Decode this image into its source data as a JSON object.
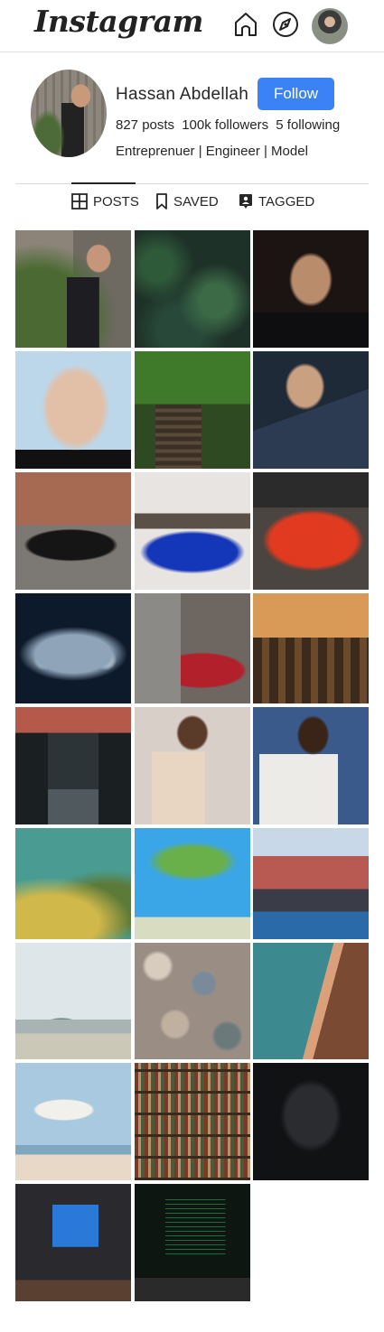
{
  "nav": {
    "logo": "Instagram",
    "home_icon": "home-icon",
    "explore_icon": "compass-icon",
    "avatar_icon": "avatar"
  },
  "profile": {
    "username": "Hassan Abdellah",
    "follow_label": "Follow",
    "posts": "827 posts",
    "followers": "100k followers",
    "following": "5 following",
    "bio": "Entreprenuer | Engineer | Model"
  },
  "tabs": [
    {
      "label": "POSTS",
      "icon": "grid-icon",
      "active": true
    },
    {
      "label": "SAVED",
      "icon": "bookmark-icon",
      "active": false
    },
    {
      "label": "TAGGED",
      "icon": "tag-icon",
      "active": false
    }
  ],
  "colors": {
    "accent": "#3b82f6",
    "text": "#262626",
    "divider": "#d9d9d9"
  },
  "posts": [
    {
      "subject": "man-sitting-wall",
      "bg": "linear-gradient(90deg,#8c8478 0 50%,#6e6a62 50%)",
      "detail": "radial-gradient(ellipse 14px 16px at 72% 24%, #c6967a 0 90%, transparent 100%), linear-gradient(180deg, transparent 0 40%, #1e1e22 40% 100%) 62% 0/28% 100% no-repeat, radial-gradient(ellipse at 20% 75%, #4b6a33 0 40%, transparent 60%)"
    },
    {
      "subject": "pine-trees",
      "bg": "#1e3128",
      "detail": "radial-gradient(circle at 20% 30%, #2f5a3a 0 12%, transparent 30%), radial-gradient(circle at 70% 60%, #3c6a47 0 15%, transparent 35%), radial-gradient(circle at 40% 85%, #28493a 0 18%, transparent 38%)"
    },
    {
      "subject": "man-glasses-dark",
      "bg": "#1b1412",
      "detail": "radial-gradient(ellipse 24px 30px at 50% 42%, #b98c6c 0 85%, transparent 100%), linear-gradient(180deg, transparent 0 70%, #0e0e10 70% 100%)"
    },
    {
      "subject": "cartoon-portrait",
      "bg": "#bcd7ea",
      "detail": "radial-gradient(ellipse 38px 48px at 52% 48%, #e2c0a8 0 80%, transparent 100%), linear-gradient(180deg, transparent 0 84%, #111 84% 100%)"
    },
    {
      "subject": "railway-forest",
      "bg": "#2d4a22",
      "detail": "linear-gradient(180deg, #3f7a2a 0 45%, transparent 45%), repeating-linear-gradient(0deg, #5a4a3a 0 4px, #3a3026 4px 9px) 30% 100%/40% 55% no-repeat"
    },
    {
      "subject": "man-sunglasses",
      "bg": "#1f2a38",
      "detail": "radial-gradient(ellipse 22px 26px at 45% 30%, #c9a080 0 85%, transparent 100%), linear-gradient(160deg, transparent 0 50%, #2c3a52 50% 100%)"
    },
    {
      "subject": "black-car-street",
      "bg": "#7c7873",
      "detail": "linear-gradient(180deg, #a66a52 0 45%, transparent 45%), radial-gradient(ellipse 52px 18px at 48% 62%, #151515 0 90%, transparent 100%)"
    },
    {
      "subject": "blue-car",
      "bg": "#e8e4e2",
      "detail": "linear-gradient(180deg, transparent 0 35%, #5a5047 35% 48%, transparent 48%), radial-gradient(ellipse 58px 24px at 50% 68%, #1436b8 0 85%, transparent 100%)"
    },
    {
      "subject": "red-car",
      "bg": "#4a4540",
      "detail": "radial-gradient(ellipse 56px 34px at 52% 58%, #e03a20 0 85%, transparent 100%), linear-gradient(180deg, #2b2b2b 0 30%, transparent 30%)"
    },
    {
      "subject": "mercedes-front",
      "bg": "#0c1a2c",
      "detail": "radial-gradient(ellipse 60px 30px at 50% 55%, #8fa4b8 0 70%, transparent 100%), radial-gradient(circle at 25% 60%, #e8f2ff 0 6%, transparent 10%), radial-gradient(circle at 78% 60%, #e8f2ff 0 6%, transparent 10%)"
    },
    {
      "subject": "red-car-city",
      "bg": "#6e6660",
      "detail": "linear-gradient(90deg, #8b8a86 0 40%, transparent 40%), radial-gradient(ellipse 50px 20px at 58% 70%, #b2202b 0 90%, transparent 100%)"
    },
    {
      "subject": "city-street-sunset",
      "bg": "#5a3a22",
      "detail": "linear-gradient(180deg, #d89a56 0 40%, transparent 40%), repeating-linear-gradient(90deg, #3c2a1c 0 10px, #6b4a2c 10px 18px) 0 100%/100% 60% no-repeat"
    },
    {
      "subject": "city-road-dusk",
      "bg": "#2c3438",
      "detail": "linear-gradient(180deg, #b55a4a 0 22%, transparent 22%), linear-gradient(90deg, #1a2022 0 28%, transparent 28% 72%, #1a2022 72%), linear-gradient(180deg, transparent 0 70%, #505a5e 70%)"
    },
    {
      "subject": "man-headphones-book",
      "bg": "#d8d0c8",
      "detail": "radial-gradient(ellipse 18px 20px at 50% 22%, #5a3a28 0 85%, transparent 100%), linear-gradient(180deg, transparent 0 38%, #e8d6c2 38% 100%) 28% 0/46% 100% no-repeat"
    },
    {
      "subject": "man-chess",
      "bg": "#3a5a8c",
      "detail": "radial-gradient(ellipse 18px 22px at 52% 24%, #3a2418 0 85%, transparent 100%), linear-gradient(180deg, transparent 0 40%, #ecebe8 40% 100%) 18% 0/68% 100% no-repeat"
    },
    {
      "subject": "aerial-beach-trees",
      "bg": "#4a9c92",
      "detail": "radial-gradient(ellipse 90px 50px at 30% 85%, #d1b84a 0 60%, transparent 100%), radial-gradient(ellipse 70px 40px at 80% 70%, #5c7a38 0 60%, transparent 100%)"
    },
    {
      "subject": "palm-tree-sky",
      "bg": "#3aa6e8",
      "detail": "radial-gradient(ellipse 50px 22px at 50% 30%, #6ab04a 0 70%, transparent 100%), linear-gradient(180deg, transparent 0 80%, #d8dcc0 80% 100%)"
    },
    {
      "subject": "cinque-terre",
      "bg": "#c8d8e8",
      "detail": "linear-gradient(180deg, transparent 0 25%, #b85a52 25% 55%, #3a3c48 55% 75%, #2a6aa8 75% 100%)"
    },
    {
      "subject": "van-beach",
      "bg": "#dfe6ea",
      "detail": "linear-gradient(180deg, transparent 0 66%, #a8b4b4 66% 78%, #ccc8b8 78% 100%), radial-gradient(ellipse 22px 10px at 40% 72%, #6e8a7e 0 90%, transparent 100%)"
    },
    {
      "subject": "pebbles",
      "bg": "#9a8e84",
      "detail": "radial-gradient(circle at 20% 20%, #d8ccbf 0 9%, transparent 12%), radial-gradient(circle at 60% 35%, #7a8a9a 0 10%, transparent 13%), radial-gradient(circle at 35% 70%, #c0b0a0 0 11%, transparent 14%), radial-gradient(circle at 80% 80%, #6a7a7a 0 9%, transparent 12%)"
    },
    {
      "subject": "aerial-coast",
      "bg": "#3c8a90",
      "detail": "linear-gradient(105deg, transparent 0 55%, #d9a07a 55% 62%, #7a4a32 62% 100%)"
    },
    {
      "subject": "beach-umbrella",
      "bg": "#a9c9e0",
      "detail": "radial-gradient(ellipse 34px 12px at 42% 40%, #f2f0ea 0 90%, transparent 100%), linear-gradient(180deg, transparent 0 70%, #7fa8c0 70% 78%, #e8d8c8 78% 100%)"
    },
    {
      "subject": "library-shelves",
      "bg": "#2a2018",
      "detail": "repeating-linear-gradient(0deg, #3a2a1e 0 3px, transparent 3px 24px), repeating-linear-gradient(90deg, #7a3a28 0 4px, #b8906a 4px 7px, #4a5a3a 7px 11px)"
    },
    {
      "subject": "hooded-figure",
      "bg": "#101214",
      "detail": "radial-gradient(ellipse 34px 40px at 50% 45%, #2a2c30 0 80%, transparent 100%), radial-gradient(circle at 38% 58%, #4ad0e0 0 3%, transparent 5%), radial-gradient(circle at 58% 62%, #4ad0e0 0 3%, transparent 5%)"
    },
    {
      "subject": "computer-desk",
      "bg": "#2a2a2e",
      "detail": "linear-gradient(90deg, transparent 0 32%, #2a78d8 32% 72%, transparent 72%) 0 28%/100% 36% no-repeat, linear-gradient(180deg, transparent 0 82%, #5a4030 82% 100%)"
    },
    {
      "subject": "code-monitors",
      "bg": "#0e1612",
      "detail": "repeating-linear-gradient(0deg, #1e6a3a 0 1px, transparent 1px 5px) 55% 20%/52% 50% no-repeat, linear-gradient(180deg, transparent 0 80%, #2a2a2a 80% 100%)"
    }
  ]
}
